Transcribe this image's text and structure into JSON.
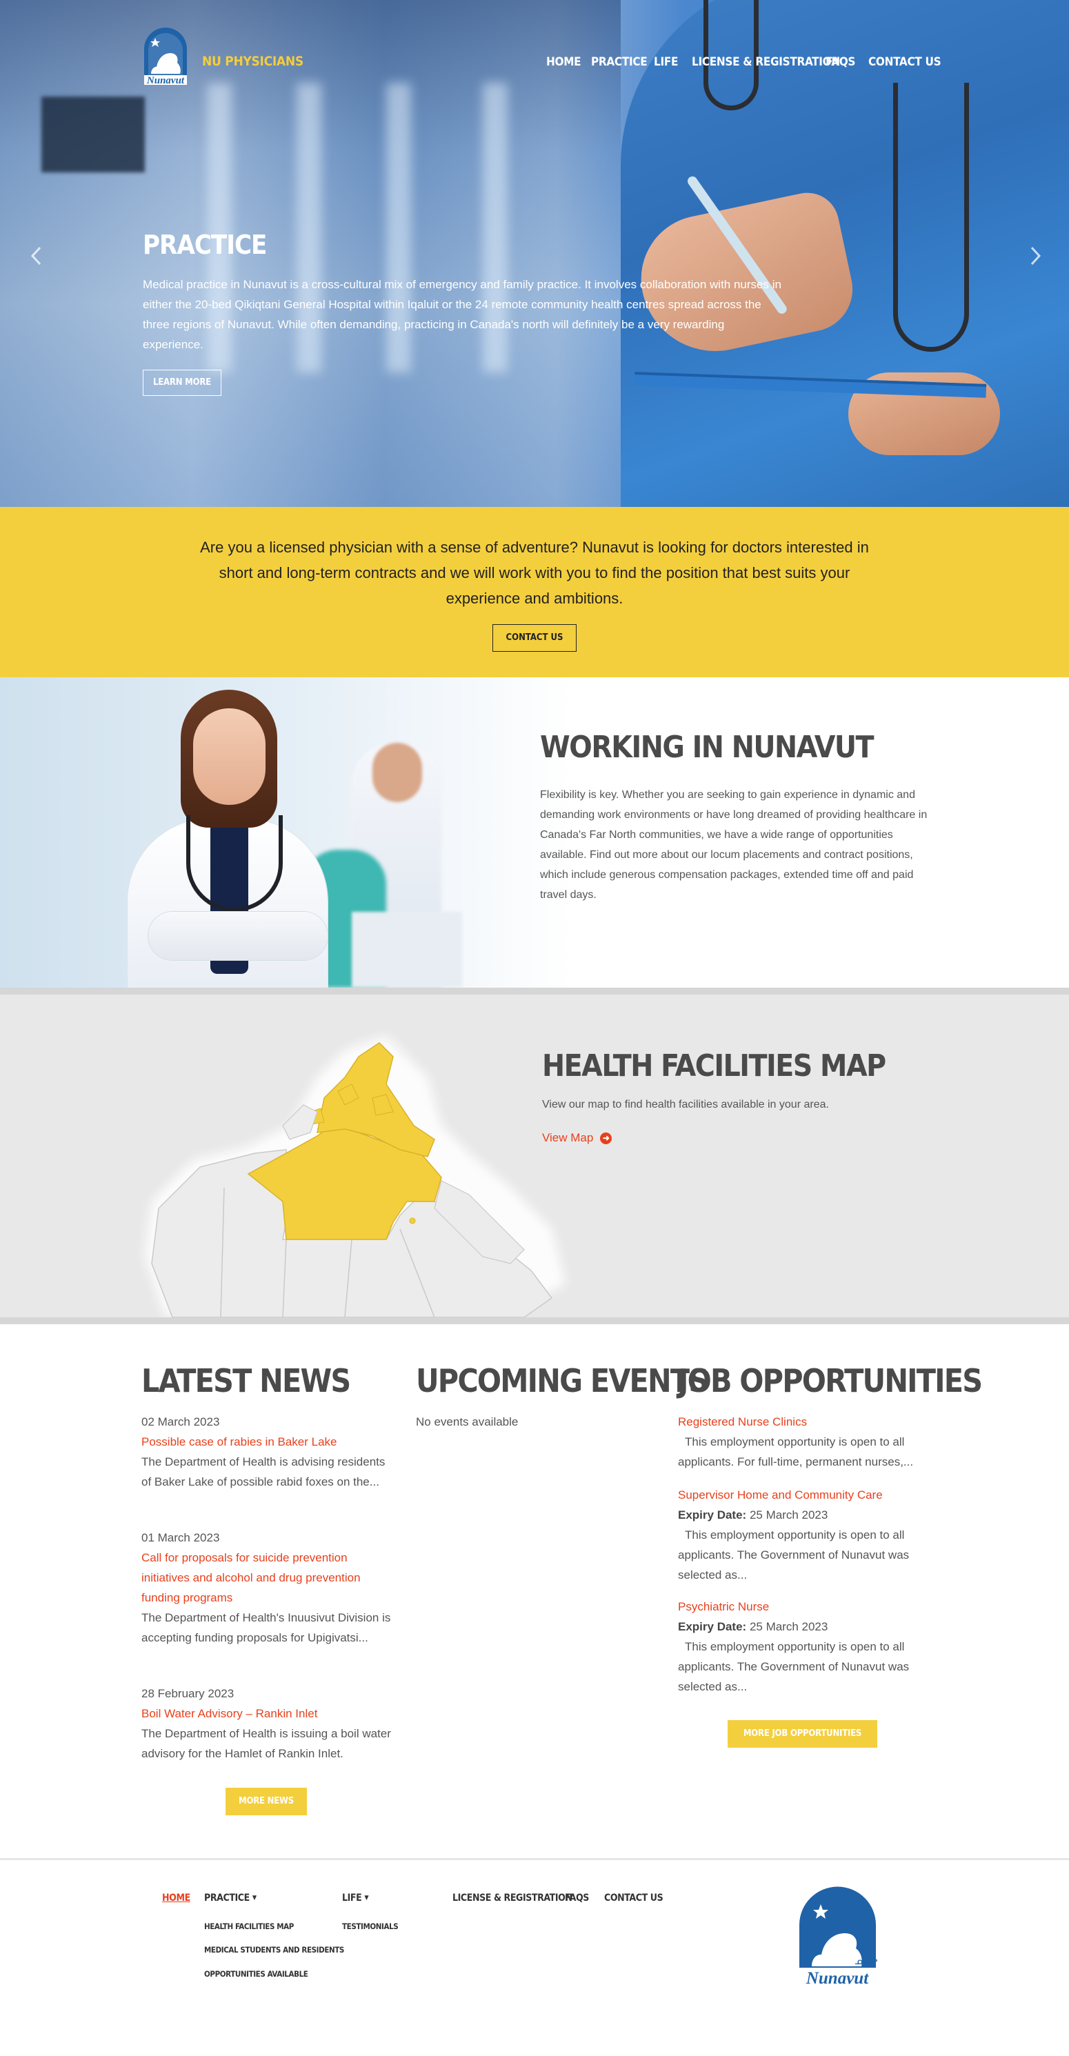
{
  "header": {
    "site_name": "NU PHYSICIANS",
    "logo_text": "Nunavut",
    "nav": [
      "HOME",
      "PRACTICE",
      "LIFE",
      "LICENSE & REGISTRATION",
      "FAQS",
      "CONTACT US"
    ]
  },
  "hero": {
    "title": "PRACTICE",
    "text": "Medical practice in Nunavut is a cross-cultural mix of emergency and family practice. It involves collaboration with nurses in either the 20-bed Qikiqtani General Hospital within Iqaluit or the 24 remote community health centres spread across the three regions of Nunavut. While often demanding, practicing in Canada's north will definitely be a very rewarding experience.",
    "button": "LEARN MORE",
    "prev_icon": "chevron-left-icon",
    "next_icon": "chevron-right-icon"
  },
  "cta": {
    "text": "Are you a licensed physician with a sense of adventure? Nunavut is looking for doctors interested in short and long-term contracts and we will work with you to find the position that best suits your experience and ambitions.",
    "button": "CONTACT US"
  },
  "working": {
    "title": "WORKING IN NUNAVUT",
    "text": "Flexibility is key. Whether you are seeking to gain experience in dynamic and demanding work environments or have long dreamed of providing healthcare in Canada's Far North communities, we have a wide range of opportunities available. Find out more about our locum placements and contract positions, which include generous compensation packages, extended time off and paid travel days."
  },
  "map": {
    "title": "HEALTH FACILITIES MAP",
    "text": "View our map to find health facilities available in your area.",
    "link": "View Map",
    "link_icon": "arrow-right-circle-icon"
  },
  "news": {
    "title": "LATEST NEWS",
    "items": [
      {
        "date": "02 March 2023",
        "headline": "Possible case of rabies in Baker Lake",
        "summary": "The Department of Health is advising residents of Baker Lake of possible rabid foxes on the..."
      },
      {
        "date": "01 March 2023",
        "headline": "Call for proposals for suicide prevention initiatives and alcohol and drug prevention funding programs",
        "summary": "The Department of Health's Inuusivut Division is accepting funding proposals for Upigivatsi..."
      },
      {
        "date": "28 February 2023",
        "headline": "Boil Water Advisory – Rankin Inlet",
        "summary": "The Department of Health is issuing a boil water advisory for the Hamlet of Rankin Inlet."
      }
    ],
    "button": "MORE NEWS"
  },
  "events": {
    "title": "UPCOMING EVENTS",
    "empty": "No events available"
  },
  "jobs": {
    "title": "JOB OPPORTUNITIES",
    "expiry_label": "Expiry Date:",
    "items": [
      {
        "title": "Registered Nurse Clinics",
        "expiry": "",
        "summary": "This employment opportunity is open to all applicants. For full-time, permanent nurses,..."
      },
      {
        "title": "Supervisor Home and Community Care",
        "expiry": "25 March 2023",
        "summary": "This employment opportunity is open to all applicants. The Government of Nunavut was selected as..."
      },
      {
        "title": "Psychiatric Nurse",
        "expiry": "25 March 2023",
        "summary": "This employment opportunity is open to all applicants. The Government of Nunavut was selected as..."
      }
    ],
    "button": "MORE JOB OPPORTUNITIES"
  },
  "footer": {
    "home": "HOME",
    "practice": "PRACTICE",
    "practice_sub": [
      "HEALTH FACILITIES MAP",
      "MEDICAL STUDENTS AND RESIDENTS",
      "OPPORTUNITIES AVAILABLE"
    ],
    "life": "LIFE",
    "life_sub": [
      "TESTIMONIALS"
    ],
    "license": "LICENSE & REGISTRATION",
    "faqs": "FAQS",
    "contact": "CONTACT US",
    "logo_text": "Nunavut",
    "logo_syllabics": "ᓄᓇᕗ"
  },
  "colors": {
    "accent_yellow": "#f4cf3d",
    "link_red": "#e8401c",
    "brand_blue": "#1f62a8",
    "heading_gray": "#4a4a4a"
  }
}
